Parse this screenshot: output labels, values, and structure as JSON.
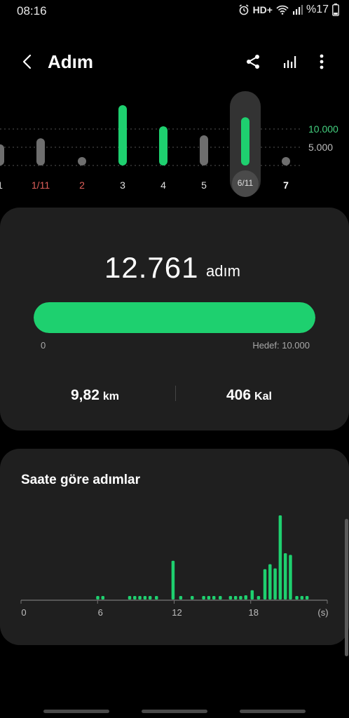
{
  "status_bar": {
    "time": "08:16",
    "network_label": "HD+",
    "battery_text": "%17"
  },
  "app_bar": {
    "title": "Adım",
    "icons": [
      "back-chevron-icon",
      "share-icon",
      "bar-stats-icon",
      "more-vert-icon"
    ]
  },
  "week": {
    "goal_primary_label": "10.000",
    "goal_secondary_label": "5.000",
    "days": [
      {
        "label": "1",
        "level": 0.35,
        "color": "#6e6e6e",
        "label_color": "normal"
      },
      {
        "label": "1/11",
        "level": 0.45,
        "color": "#6e6e6e",
        "label_color": "red"
      },
      {
        "label": "2",
        "level": 0.1,
        "color": "#6e6e6e",
        "label_color": "red"
      },
      {
        "label": "3",
        "level": 1.0,
        "color": "#1ed06f",
        "label_color": "normal"
      },
      {
        "label": "4",
        "level": 0.65,
        "color": "#1ed06f",
        "label_color": "normal"
      },
      {
        "label": "5",
        "level": 0.5,
        "color": "#6e6e6e",
        "label_color": "normal"
      },
      {
        "label": "6/11",
        "level": 0.8,
        "color": "#1ed06f",
        "label_color": "selected"
      },
      {
        "label": "7",
        "level": 0.08,
        "color": "#6e6e6e",
        "label_color": "today"
      }
    ]
  },
  "summary": {
    "steps_value": "12.761",
    "steps_unit": "adım",
    "progress_fraction": 1.0,
    "progress_min": "0",
    "progress_goal": "Hedef: 10.000",
    "distance_value": "9,82",
    "distance_unit": "km",
    "calorie_value": "406",
    "calorie_unit": "Kal"
  },
  "hourly": {
    "title": "Saate göre adımlar",
    "axis_labels": [
      "0",
      "6",
      "12",
      "18",
      "(s)"
    ],
    "bars": [
      {
        "hour": 6.0,
        "level": 0.03
      },
      {
        "hour": 6.4,
        "level": 0.03
      },
      {
        "hour": 8.5,
        "level": 0.03
      },
      {
        "hour": 8.9,
        "level": 0.03
      },
      {
        "hour": 9.3,
        "level": 0.03
      },
      {
        "hour": 9.7,
        "level": 0.03
      },
      {
        "hour": 10.1,
        "level": 0.03
      },
      {
        "hour": 10.6,
        "level": 0.03
      },
      {
        "hour": 11.9,
        "level": 0.46
      },
      {
        "hour": 12.5,
        "level": 0.03
      },
      {
        "hour": 13.4,
        "level": 0.03
      },
      {
        "hour": 14.3,
        "level": 0.03
      },
      {
        "hour": 14.7,
        "level": 0.03
      },
      {
        "hour": 15.1,
        "level": 0.03
      },
      {
        "hour": 15.6,
        "level": 0.03
      },
      {
        "hour": 16.4,
        "level": 0.03
      },
      {
        "hour": 16.8,
        "level": 0.03
      },
      {
        "hour": 17.2,
        "level": 0.03
      },
      {
        "hour": 17.6,
        "level": 0.05
      },
      {
        "hour": 18.1,
        "level": 0.11
      },
      {
        "hour": 18.6,
        "level": 0.03
      },
      {
        "hour": 19.1,
        "level": 0.36
      },
      {
        "hour": 19.5,
        "level": 0.42
      },
      {
        "hour": 19.9,
        "level": 0.37
      },
      {
        "hour": 20.3,
        "level": 1.0
      },
      {
        "hour": 20.7,
        "level": 0.55
      },
      {
        "hour": 21.1,
        "level": 0.53
      },
      {
        "hour": 21.6,
        "level": 0.03
      },
      {
        "hour": 22.0,
        "level": 0.03
      },
      {
        "hour": 22.4,
        "level": 0.03
      }
    ]
  }
}
